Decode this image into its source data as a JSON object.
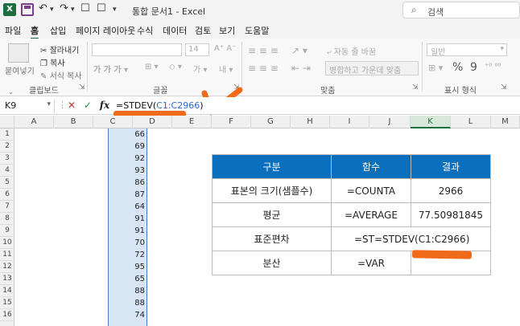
{
  "titlebar": {
    "logo": "X",
    "title": "통합 문서1 - Excel",
    "search_icon": "⌕",
    "search_label": "검색",
    "undo_icon": "↶",
    "redo_icon": "↷",
    "menu_icon": "▾",
    "qat_icon": "☐"
  },
  "menus": [
    "파일",
    "홈",
    "삽입",
    "페이지 레이아웃",
    "수식",
    "데이터",
    "검토",
    "보기",
    "도움말"
  ],
  "ribbon": {
    "paste": "붙여넣기",
    "cut": "잘라내기",
    "copy": "복사",
    "format_painter": "서식 복사",
    "clipboard_label": "클립보드",
    "font_size": "14",
    "font_label": "글꼴",
    "wrap_text": "자동 줄 바꿈",
    "merge": "병합하고 가운데 맞춤",
    "align_label": "맞춤",
    "number_format": "일반",
    "percent": "%",
    "comma": "9",
    "number_label": "표시 형식"
  },
  "formula_bar": {
    "namebox": "K9",
    "formula_prefix": "=STDEV(",
    "formula_ref": "C1:C2966",
    "formula_suffix": ")"
  },
  "columns": [
    "A",
    "B",
    "C",
    "D",
    "E",
    "F",
    "G",
    "H",
    "I",
    "J",
    "K",
    "L",
    "M"
  ],
  "rows": [
    "1",
    "2",
    "3",
    "4",
    "5",
    "6",
    "7",
    "8",
    "9",
    "10",
    "11",
    "12",
    "13",
    "14",
    "15",
    "16"
  ],
  "column_c_values": [
    "66",
    "69",
    "92",
    "93",
    "86",
    "87",
    "64",
    "91",
    "91",
    "70",
    "72",
    "95",
    "65",
    "88",
    "88",
    "74"
  ],
  "summary": {
    "headers": [
      "구분",
      "함수",
      "결과"
    ],
    "rows": [
      [
        "표본의 크기(샘플수)",
        "=COUNTA",
        "2966"
      ],
      [
        "평균",
        "=AVERAGE",
        "77.50981845"
      ],
      [
        "표준편차",
        "=ST=STDEV(C1:C2966)",
        ""
      ],
      [
        "분산",
        "=VAR",
        ""
      ]
    ]
  }
}
